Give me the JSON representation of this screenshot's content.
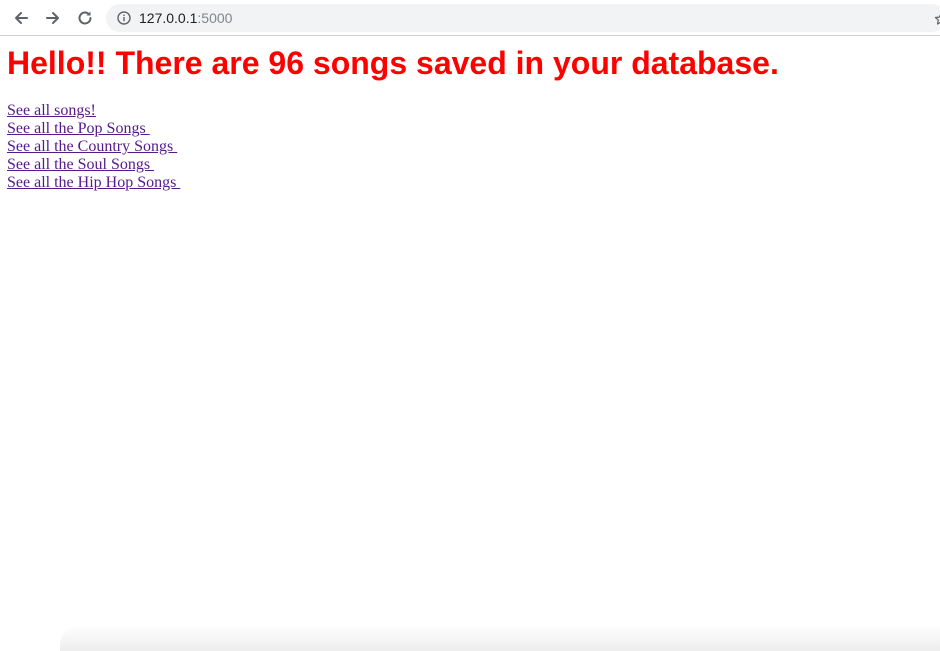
{
  "browser": {
    "url_host": "127.0.0.1",
    "url_port": ":5000"
  },
  "page": {
    "heading": "Hello!! There are 96 songs saved in your database.",
    "links": [
      {
        "label": "See all songs!"
      },
      {
        "label": "See all the Pop Songs "
      },
      {
        "label": "See all the Country Songs "
      },
      {
        "label": "See all the Soul Songs "
      },
      {
        "label": "See all the Hip Hop Songs "
      }
    ]
  },
  "colors": {
    "heading": "#ff0000",
    "visited_link": "#551a8b"
  },
  "icons": {
    "back": "arrow-left-icon",
    "forward": "arrow-right-icon",
    "reload": "reload-icon",
    "info": "info-icon",
    "bookmark": "star-icon"
  }
}
